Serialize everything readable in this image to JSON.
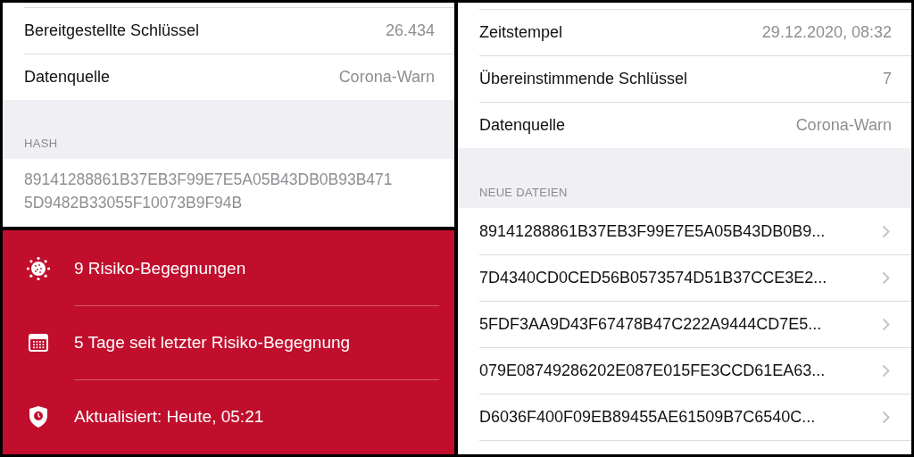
{
  "key_details": {
    "rows": [
      {
        "label": "Bereitgestellte Schlüssel",
        "value": "26.434"
      },
      {
        "label": "Datenquelle",
        "value": "Corona-Warn"
      }
    ],
    "hash_section": {
      "header": "HASH",
      "hash": "89141288861B37EB3F99E7E5A05B43DB0B93B4715D9482B33055F10073B9F94B"
    }
  },
  "risk_card": {
    "items": [
      {
        "kind": "virus",
        "text": "9 Risiko-Begegnungen"
      },
      {
        "kind": "calendar",
        "text": "5 Tage seit letzter Risiko-Begegnung"
      },
      {
        "kind": "shield",
        "text": "Aktualisiert: Heute, 05:21"
      }
    ]
  },
  "check_details": {
    "rows": [
      {
        "label": "Zeitstempel",
        "value": "29.12.2020, 08:32"
      },
      {
        "label": "Übereinstimmende Schlüssel",
        "value": "7"
      },
      {
        "label": "Datenquelle",
        "value": "Corona-Warn"
      }
    ],
    "files_section": {
      "header": "NEUE DATEIEN",
      "files": [
        "89141288861B37EB3F99E7E5A05B43DB0B9...",
        "7D4340CD0CED56B0573574D51B37CCE3E2...",
        "5FDF3AA9D43F67478B47C222A9444CD7E5...",
        "079E08749286202E087E015FE3CCD61EA63...",
        "D6036F400F09EB89455AE61509B7C6540C..."
      ]
    }
  }
}
